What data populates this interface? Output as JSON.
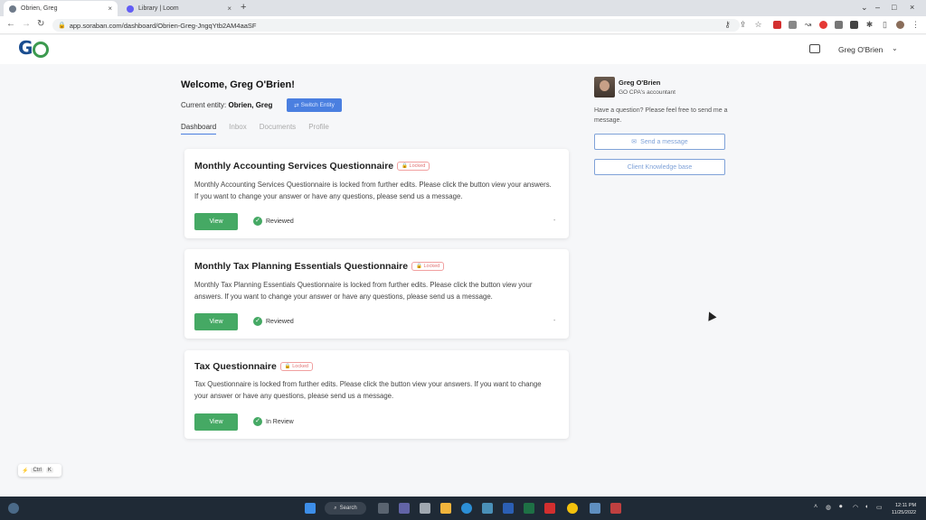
{
  "browser": {
    "tabs": [
      {
        "label": "Obrien, Greg",
        "active": true
      },
      {
        "label": "Library | Loom",
        "active": false
      }
    ],
    "url": "app.soraban.com/dashboard/Obrien-Greg-JngqYtb2AM4aaSF"
  },
  "header": {
    "logo_text": "GO",
    "user_name": "Greg O'Brien"
  },
  "main": {
    "welcome": "Welcome, Greg O'Brien!",
    "entity_label": "Current entity:",
    "entity_value": "Obrien, Greg",
    "switch_label": "Switch Entity",
    "tabs": [
      "Dashboard",
      "Inbox",
      "Documents",
      "Profile"
    ],
    "cards": [
      {
        "title": "Monthly Accounting Services Questionnaire",
        "badge": "Locked",
        "desc": "Monthly Accounting Services Questionnaire is locked from further edits. Please click the button view your answers. If you want to change your answer or have any questions, please send us a message.",
        "button": "View",
        "status": "Reviewed",
        "dash": "-"
      },
      {
        "title": "Monthly Tax Planning Essentials Questionnaire",
        "badge": "Locked",
        "desc": "Monthly Tax Planning Essentials Questionnaire is locked from further edits. Please click the button view your answers. If you want to change your answer or have any questions, please send us a message.",
        "button": "View",
        "status": "Reviewed",
        "dash": "-"
      },
      {
        "title": "Tax Questionnaire",
        "badge": "Locked",
        "desc": "Tax Questionnaire is locked from further edits. Please click the button view your answers. If you want to change your answer or have any questions, please send us a message.",
        "button": "View",
        "status": "In Review",
        "dash": ""
      }
    ]
  },
  "sidebar": {
    "accountant_name": "Greg O'Brien",
    "accountant_role": "GO CPA's accountant",
    "question": "Have a question? Please feel free to send me a message.",
    "send_message": "Send a message",
    "knowledge_base": "Client Knowledge base"
  },
  "shortcut": {
    "key1": "Ctrl",
    "key2": "K"
  },
  "taskbar": {
    "search_label": "Search",
    "time": "12:11 PM",
    "date": "11/25/2022"
  },
  "colors": {
    "accent": "#4a7fe0",
    "success": "#45a964",
    "locked": "#e07070"
  }
}
